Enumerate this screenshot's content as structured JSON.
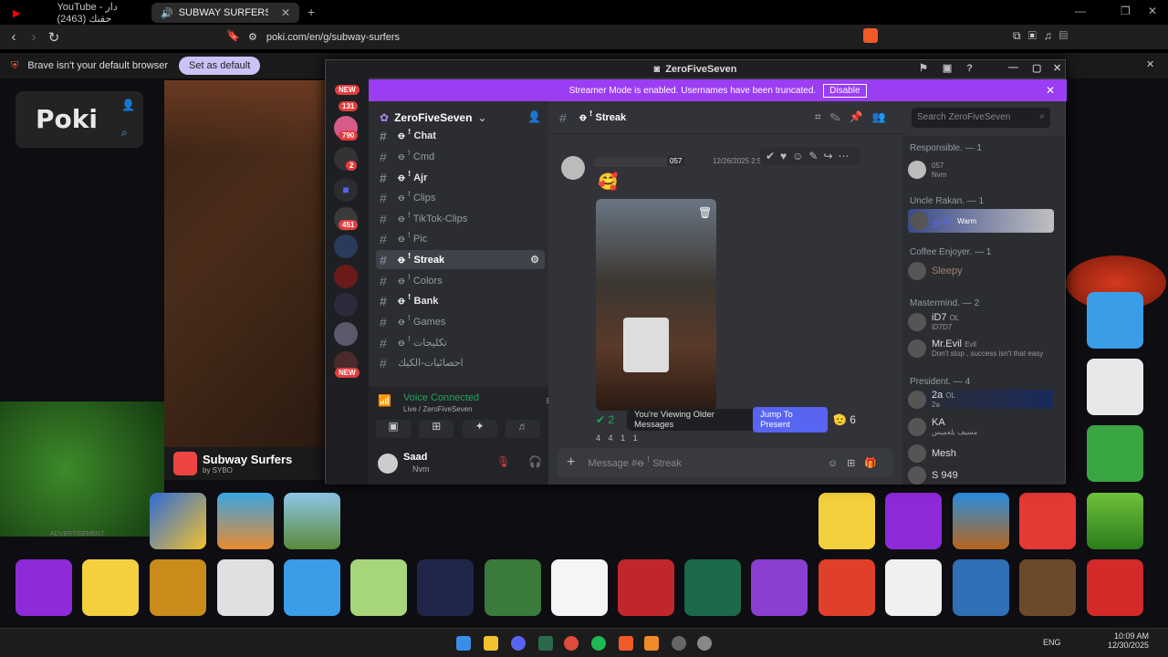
{
  "browser": {
    "tabs": [
      {
        "label": "YouTube - دار حقنك (2463)"
      },
      {
        "label": "SUBWAY SURFERS - Play Onli..."
      }
    ],
    "url": "poki.com/en/g/subway-surfers",
    "infobar_text": "Brave isn't your default browser",
    "set_default": "Set as default"
  },
  "game_page": {
    "game_title": "Subway Surfers",
    "game_by": "by SYBO",
    "advertisement": "ADVERTISEMENT"
  },
  "discord": {
    "window_title": "ZeroFiveSeven",
    "streamer_notice": "Streamer Mode is enabled. Usernames have been truncated.",
    "disable_label": "Disable",
    "server_name": "ZeroFiveSeven",
    "badges": [
      "NEW",
      "131",
      "790",
      "2",
      "451",
      "NEW"
    ],
    "channels": [
      {
        "name": "ꝋ ꜝ Chat",
        "style": "bold"
      },
      {
        "name": "ꝋ ꜝ Cmd",
        "style": "normal"
      },
      {
        "name": "ꝋ ꜝ Ajr",
        "style": "bold"
      },
      {
        "name": "ꝋ ꜝ Clips",
        "style": "normal"
      },
      {
        "name": "ꝋ ꜝ TikTok-Clips",
        "style": "normal"
      },
      {
        "name": "ꝋ ꜝ Pic",
        "style": "normal"
      },
      {
        "name": "ꝋ ꜝ Streak",
        "style": "selected"
      },
      {
        "name": "ꝋ ꜝ Colors",
        "style": "normal"
      },
      {
        "name": "ꝋ ꜝ Bank",
        "style": "bold"
      },
      {
        "name": "ꝋ ꜝ Games",
        "style": "normal"
      },
      {
        "name": "ꝋ ꜝ تكليجات",
        "style": "normal"
      },
      {
        "name": "احصائيات-الكيك",
        "style": "normal"
      }
    ],
    "voice": {
      "status": "Voice Connected",
      "sub": "Live / ZeroFiveSeven"
    },
    "user": {
      "name": "Saad",
      "status": "Nvm"
    },
    "chat_header": "ꝋ ꜝ Streak",
    "search_placeholder": "Search ZeroFiveSeven",
    "message": {
      "tag": "057",
      "time": "12/26/2025 2:5..."
    },
    "older_notice": "You're Viewing Older Messages",
    "jump_label": "Jump To Present",
    "reaction_counts": [
      "2",
      "6",
      "4",
      "4",
      "1",
      "1"
    ],
    "composer_placeholder": "Message #ꝋ ꜝ Streak",
    "member_groups": [
      {
        "label": "Responsible. — 1",
        "members": [
          {
            "name": "",
            "tag": "057",
            "sub": "Nvm"
          }
        ]
      },
      {
        "label": "Uncle Rakan. — 1",
        "members": [
          {
            "name": "عادو",
            "tag": "Warm",
            "sub": ""
          }
        ]
      },
      {
        "label": "Coffee Enjoyer. — 1",
        "members": [
          {
            "name": "Sleepy",
            "tag": "",
            "sub": ""
          }
        ]
      },
      {
        "label": "Mastermind. — 2",
        "members": [
          {
            "name": "iD7",
            "tag": "OL",
            "sub": "iD7D7"
          },
          {
            "name": "Mr.Evil",
            "tag": "Evil",
            "sub": "Don't stop , success isn't that easy"
          }
        ]
      },
      {
        "label": "President. — 4",
        "members": [
          {
            "name": "2a",
            "tag": "OL",
            "sub": "2a"
          },
          {
            "name": "KA",
            "tag": "",
            "sub": "مسيف بلعميس"
          },
          {
            "name": "Mesh",
            "tag": "",
            "sub": ""
          },
          {
            "name": "S 949",
            "tag": "",
            "sub": ""
          }
        ]
      }
    ]
  },
  "taskbar": {
    "lang": "ENG",
    "time": "10:09 AM",
    "date": "12/30/2025"
  },
  "colors": {
    "accent": "#5865f2",
    "streamer": "#9b3df3",
    "online": "#23a55a"
  }
}
